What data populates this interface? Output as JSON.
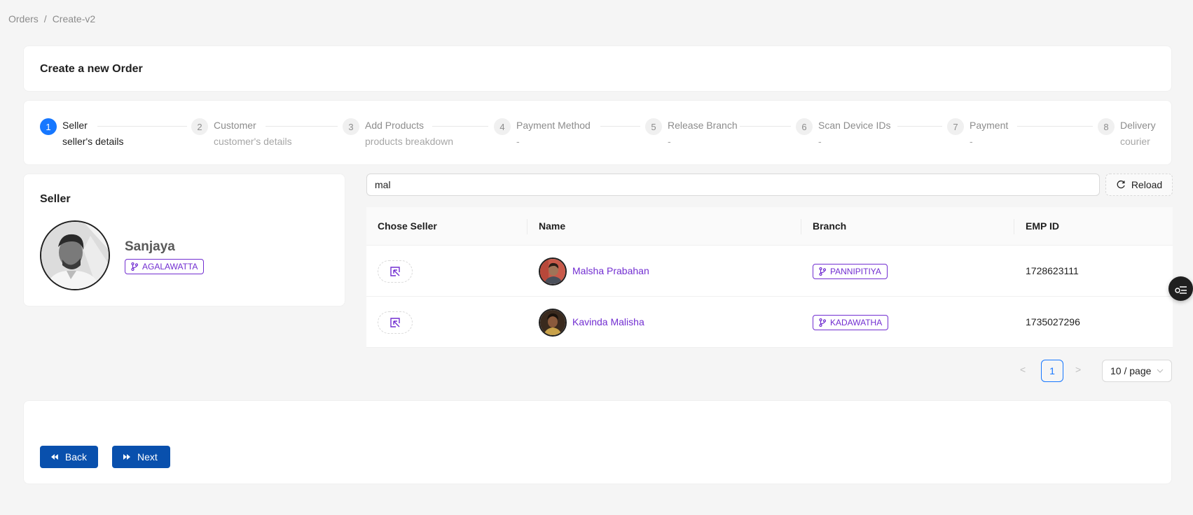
{
  "breadcrumb": {
    "items": [
      "Orders",
      "Create-v2"
    ],
    "separator": "/"
  },
  "page": {
    "title": "Create a new Order"
  },
  "steps": [
    {
      "num": "1",
      "title": "Seller",
      "desc": "seller's details",
      "active": true
    },
    {
      "num": "2",
      "title": "Customer",
      "desc": "customer's details"
    },
    {
      "num": "3",
      "title": "Add Products",
      "desc": "products breakdown"
    },
    {
      "num": "4",
      "title": "Payment Method",
      "desc": "-"
    },
    {
      "num": "5",
      "title": "Release Branch",
      "desc": "-"
    },
    {
      "num": "6",
      "title": "Scan Device IDs",
      "desc": "-"
    },
    {
      "num": "7",
      "title": "Payment",
      "desc": "-"
    },
    {
      "num": "8",
      "title": "Delivery",
      "desc": "courier"
    }
  ],
  "seller": {
    "heading": "Seller",
    "name": "Sanjaya",
    "branch": "AGALAWATTA"
  },
  "search": {
    "value": "mal"
  },
  "reload": {
    "label": "Reload"
  },
  "table": {
    "headers": [
      "Chose Seller",
      "Name",
      "Branch",
      "EMP ID"
    ],
    "rows": [
      {
        "name": "Malsha Prabahan",
        "branch": "PANNIPITIYA",
        "emp_id": "1728623111"
      },
      {
        "name": "Kavinda Malisha",
        "branch": "KADAWATHA",
        "emp_id": "1735027296"
      }
    ]
  },
  "pagination": {
    "current": "1",
    "page_size": "10 / page",
    "prev": "<",
    "next": ">"
  },
  "footer": {
    "back_label": "Back",
    "next_label": "Next"
  },
  "colors": {
    "primary": "#1677ff",
    "button": "#0950ad",
    "tag": "#722ed1"
  }
}
